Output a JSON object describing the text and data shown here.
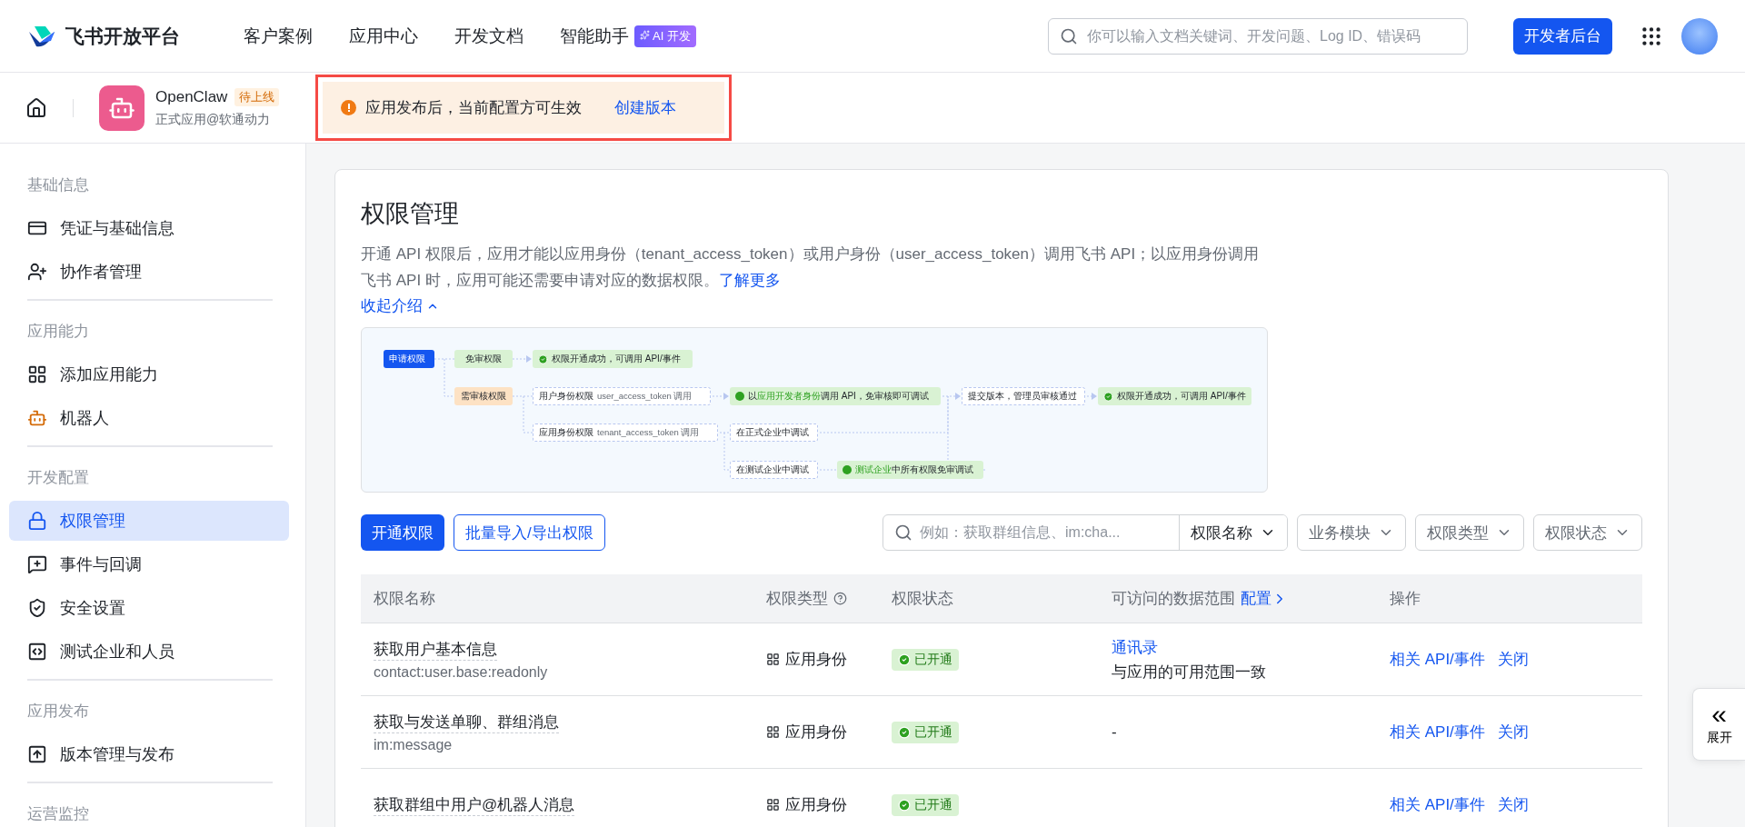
{
  "header": {
    "brand": "飞书开放平台",
    "nav": [
      {
        "label": "客户案例"
      },
      {
        "label": "应用中心"
      },
      {
        "label": "开发文档"
      },
      {
        "label": "智能助手",
        "badge": "AI 开发"
      }
    ],
    "search": {
      "placeholder": "你可以输入文档关键词、开发问题、Log ID、错误码"
    },
    "console_button": "开发者后台"
  },
  "app_bar": {
    "name": "OpenClaw",
    "status": "待上线",
    "subtitle": "正式应用@软通动力",
    "notice": {
      "text": "应用发布后，当前配置方可生效",
      "link": "创建版本"
    }
  },
  "sidebar": {
    "sections": [
      {
        "title": "基础信息",
        "items": [
          {
            "label": "凭证与基础信息",
            "selected": false
          },
          {
            "label": "协作者管理",
            "selected": false
          }
        ]
      },
      {
        "title": "应用能力",
        "items": [
          {
            "label": "添加应用能力",
            "selected": false
          },
          {
            "label": "机器人",
            "selected": false
          }
        ]
      },
      {
        "title": "开发配置",
        "items": [
          {
            "label": "权限管理",
            "selected": true
          },
          {
            "label": "事件与回调",
            "selected": false
          },
          {
            "label": "安全设置",
            "selected": false
          },
          {
            "label": "测试企业和人员",
            "selected": false
          }
        ]
      },
      {
        "title": "应用发布",
        "items": [
          {
            "label": "版本管理与发布",
            "selected": false
          }
        ]
      },
      {
        "title": "运营监控"
      }
    ]
  },
  "page": {
    "title": "权限管理",
    "description": "开通 API 权限后，应用才能以应用身份（tenant_access_token）或用户身份（user_access_token）调用飞书 API；以应用身份调用飞书 API 时，应用可能还需要申请对应的数据权限。",
    "learn_more": "了解更多",
    "collapse": "收起介绍"
  },
  "diagram": {
    "nodes": [
      {
        "kind": "start",
        "label": "申请权限"
      },
      {
        "kind": "free",
        "label": "免审权限"
      },
      {
        "kind": "success",
        "label": "权限开通成功，可调用 API/事件"
      },
      {
        "kind": "review",
        "label": "需审核权限"
      },
      {
        "kind": "plain",
        "label": "用户身份权限",
        "note": "user_access_token 调用"
      },
      {
        "kind": "info",
        "label": "以**应用开发者身份**调用 API，免审核即可调试"
      },
      {
        "kind": "plain",
        "label": "提交版本，管理员审核通过"
      },
      {
        "kind": "success",
        "label": "权限开通成功，可调用 API/事件"
      },
      {
        "kind": "plain",
        "label": "应用身份权限",
        "note": "tenant_access_token 调用"
      },
      {
        "kind": "plain",
        "label": "在正式企业中调试"
      },
      {
        "kind": "plain",
        "label": "在测试企业中调试"
      },
      {
        "kind": "info",
        "label": "**测试企业**中所有权限免审调试"
      }
    ]
  },
  "toolbar": {
    "primary": "开通权限",
    "secondary": "批量导入/导出权限",
    "search": {
      "placeholder": "例如：获取群组信息、im:cha..."
    },
    "filters": [
      "权限名称",
      "业务模块",
      "权限类型",
      "权限状态"
    ]
  },
  "table": {
    "columns": [
      "权限名称",
      "权限类型",
      "权限状态",
      "可访问的数据范围",
      "操作"
    ],
    "scope_config": "配置",
    "rows": [
      {
        "name": "获取用户基本信息",
        "code": "contact:user.base:readonly",
        "type": "应用身份",
        "status": "已开通",
        "scope_link": "通讯录",
        "scope_text": "与应用的可用范围一致",
        "actions": [
          "相关 API/事件",
          "关闭"
        ]
      },
      {
        "name": "获取与发送单聊、群组消息",
        "code": "im:message",
        "type": "应用身份",
        "status": "已开通",
        "scope_text": "-",
        "actions": [
          "相关 API/事件",
          "关闭"
        ]
      },
      {
        "name": "获取群组中用户@机器人消息",
        "type": "应用身份",
        "status": "已开通",
        "actions": [
          "相关 API/事件",
          "关闭"
        ]
      }
    ]
  },
  "side_toggle": {
    "icon": "«",
    "label": "展开"
  }
}
